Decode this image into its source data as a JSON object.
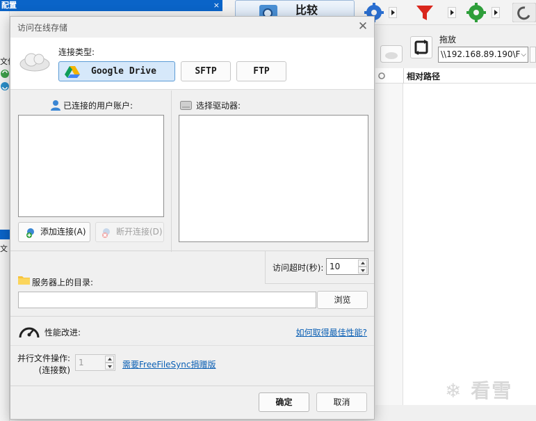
{
  "background": {
    "left_title": "配置",
    "close_glyph": "×",
    "left_tab_1": "文件",
    "left_tab_2": "文",
    "compare_label": "比较",
    "drag_label": "拖放",
    "path_value": "\\\\192.168.89.190\\F",
    "column_header": "相对路径",
    "watermark": "看雪",
    "colors": {
      "title_bar": "#0a64c8",
      "compare_bg": "#d7e6f7",
      "filter_red": "#d9261c",
      "gear_blue": "#2b6fd1",
      "gear_green": "#2e9e3a"
    }
  },
  "dialog": {
    "title": "访问在线存储",
    "close_glyph": "✕",
    "connection_type_label": "连接类型:",
    "connection_types": [
      "Google Drive",
      "SFTP",
      "FTP"
    ],
    "selected_type": "Google Drive",
    "accounts_label": "已连接的用户账户:",
    "add_connection": "添加连接(A)",
    "disconnect": "断开连接(D)",
    "drives_label": "选择驱动器:",
    "timeout_label": "访问超时(秒):",
    "timeout_value": "10",
    "server_dir_label": "服务器上的目录:",
    "server_dir_value": "",
    "browse": "浏览",
    "performance_label": "性能改进:",
    "performance_link": "如何取得最佳性能?",
    "parallel_label_1": "并行文件操作:",
    "parallel_label_2": "(连接数)",
    "parallel_value": "1",
    "donate_link": "需要FreeFileSync捐赠版",
    "ok": "确定",
    "cancel": "取消"
  }
}
